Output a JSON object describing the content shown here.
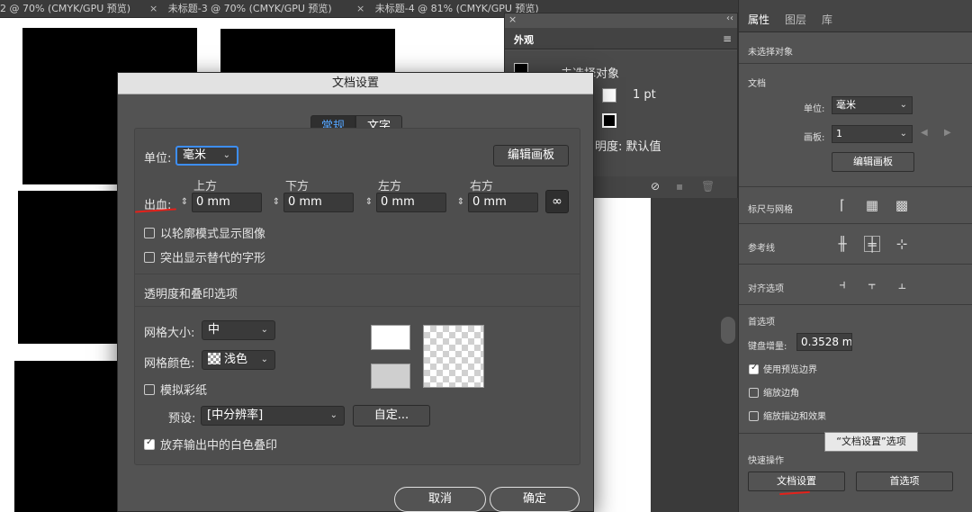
{
  "tabs": [
    {
      "label": "2 @ 70% (CMYK/GPU 预览)",
      "close": ""
    },
    {
      "label": "未标题-3 @ 70% (CMYK/GPU 预览)",
      "close": "×"
    },
    {
      "label": "未标题-4 @ 81% (CMYK/GPU 预览)",
      "close": "×"
    }
  ],
  "appearance_panel": {
    "close": "×",
    "collapse": "‹‹",
    "title": "外观",
    "menu": "≡",
    "no_selection": "未选择对象",
    "stroke_width": "1 pt",
    "opacity": "明度: 默认值",
    "footer_icons": [
      "clear-appearance-icon",
      "duplicate-icon",
      "trash-icon"
    ]
  },
  "properties_panel": {
    "tabs": [
      "属性",
      "图层",
      "库"
    ],
    "active_tab": "属性",
    "no_selection": "未选择对象",
    "document_heading": "文档",
    "units_label": "单位:",
    "units_value": "毫米",
    "artboard_label": "画板:",
    "artboard_value": "1",
    "edit_artboards": "编辑画板",
    "rulers_grids": "标尺与网格",
    "guides": "参考线",
    "snap_options": "对齐选项",
    "preferences_heading": "首选项",
    "keyboard_increment_label": "键盘增量:",
    "keyboard_increment_value": "0.3528 m",
    "use_preview_bounds": "使用预览边界",
    "scale_corners": "缩放边角",
    "scale_strokes": "缩放描边和效果",
    "quick_actions": "快速操作",
    "doc_setup_button": "文档设置",
    "preferences_button": "首选项",
    "tooltip": "“文档设置”选项",
    "checks": {
      "use_preview_bounds": true,
      "scale_corners": false,
      "scale_strokes": false
    }
  },
  "dialog": {
    "title": "文档设置",
    "tab_general": "常规",
    "tab_type": "文字",
    "units_label": "单位:",
    "units_value": "毫米",
    "edit_artboards": "编辑画板",
    "bleed_label": "出血:",
    "bleed_headers": [
      "上方",
      "下方",
      "左方",
      "右方"
    ],
    "bleed_values": [
      "0 mm",
      "0 mm",
      "0 mm",
      "0 mm"
    ],
    "link_icon": "∞",
    "show_outline_images": "以轮廓模式显示图像",
    "highlight_glyphs": "突出显示替代的字形",
    "transparency_heading": "透明度和叠印选项",
    "grid_size_label": "网格大小:",
    "grid_size_value": "中",
    "grid_colors_label": "网格颜色:",
    "grid_colors_value": "浅色",
    "simulate_paper": "模拟彩纸",
    "preset_label": "预设:",
    "preset_value": "[中分辨率]",
    "custom_button": "自定...",
    "discard_white_overprint": "放弃输出中的白色叠印",
    "cancel": "取消",
    "ok": "确定",
    "checks": {
      "show_outline_images": false,
      "highlight_glyphs": false,
      "simulate_paper": false,
      "discard_white_overprint": true
    }
  },
  "colors": {
    "accent": "#3d8ef5",
    "annotation": "#e4211a"
  }
}
